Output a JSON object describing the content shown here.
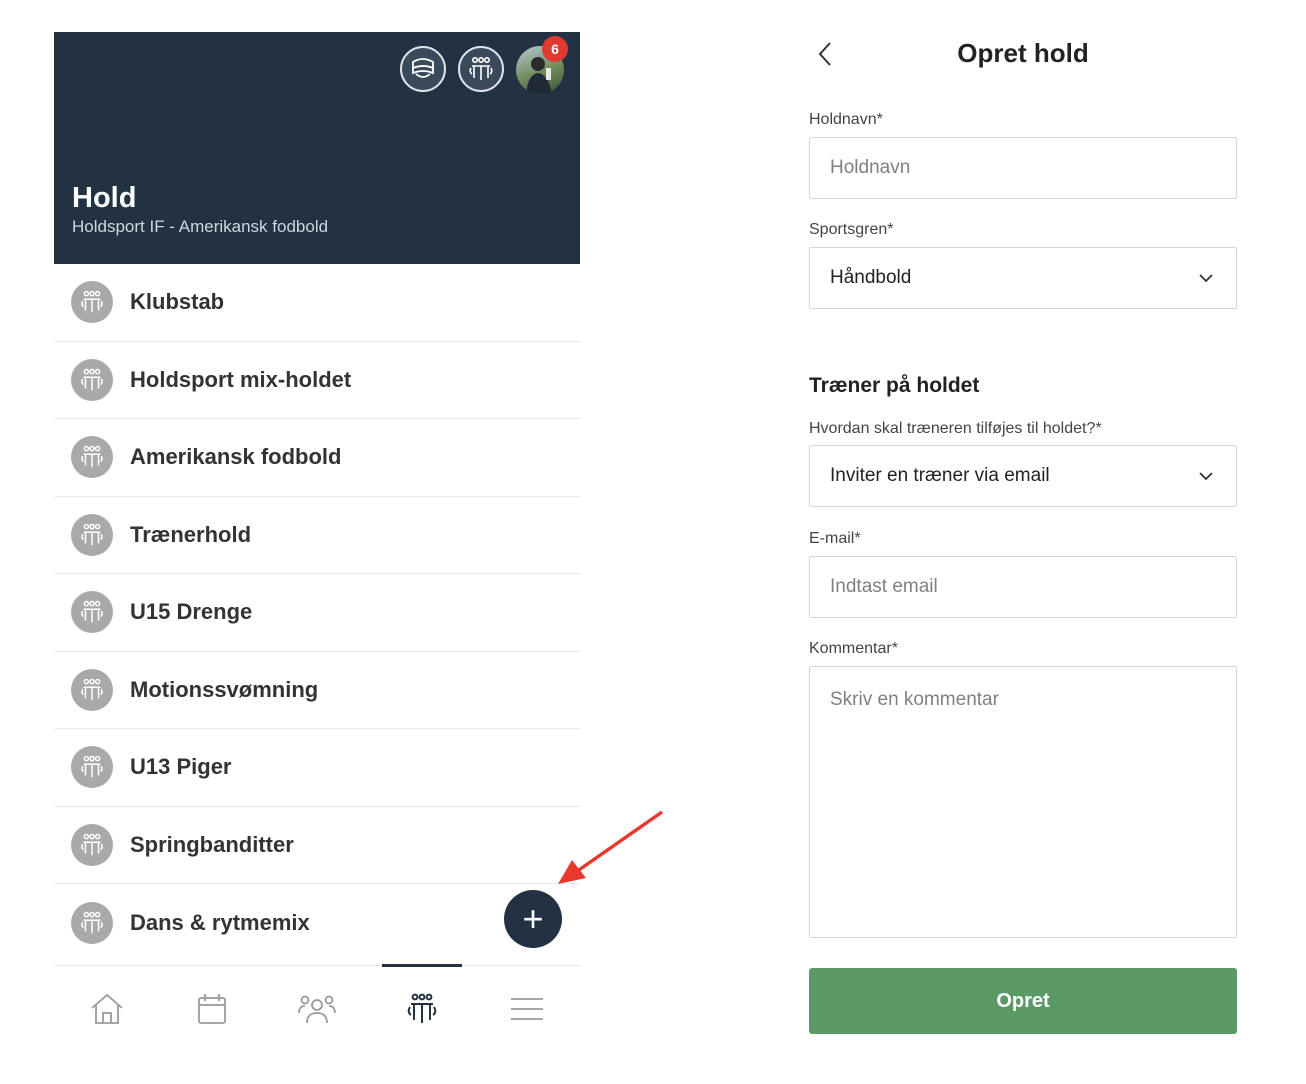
{
  "left_screen": {
    "header": {
      "title": "Hold",
      "subtitle": "Holdsport IF - Amerikansk fodbold",
      "icons": [
        "club-badge-icon",
        "team-icon",
        "avatar"
      ],
      "notification_count": "6",
      "colors": {
        "background": "#223243",
        "badge": "#e2392f"
      }
    },
    "teams": [
      {
        "name": "Klubstab"
      },
      {
        "name": "Holdsport mix-holdet"
      },
      {
        "name": "Amerikansk fodbold"
      },
      {
        "name": "Trænerhold"
      },
      {
        "name": "U15 Drenge"
      },
      {
        "name": "Motionssvømning"
      },
      {
        "name": "U13 Piger"
      },
      {
        "name": "Springbanditter"
      },
      {
        "name": "Dans & rytmemix"
      }
    ],
    "fab": {
      "symbol": "+",
      "icon": "plus-icon"
    },
    "tabbar": {
      "items": [
        "home-icon",
        "calendar-icon",
        "members-icon",
        "teams-icon",
        "menu-icon"
      ],
      "active": "teams-icon"
    }
  },
  "right_screen": {
    "title": "Opret hold",
    "fields": {
      "team_name": {
        "label": "Holdnavn*",
        "placeholder": "Holdnavn"
      },
      "sport": {
        "label": "Sportsgren*",
        "value": "Håndbold"
      },
      "section_heading": "Træner på holdet",
      "add_method": {
        "label": "Hvordan skal træneren tilføjes til holdet?*",
        "value": "Inviter en træner via email"
      },
      "email": {
        "label": "E-mail*",
        "placeholder": "Indtast email"
      },
      "comment": {
        "label": "Kommentar*",
        "placeholder": "Skriv en kommentar"
      }
    },
    "submit_label": "Opret",
    "colors": {
      "submit": "#5b9a66"
    }
  }
}
